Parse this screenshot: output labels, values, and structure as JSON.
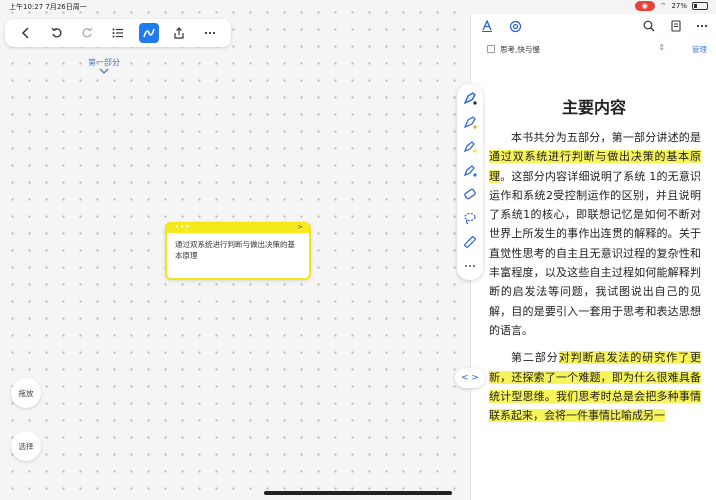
{
  "status_bar": {
    "time": "上午10:27  7月26日周一",
    "battery": "27%"
  },
  "toolbar": {
    "icons": [
      "chevron-left-icon",
      "undo-icon",
      "redo-icon",
      "outline-list-icon",
      "pen-mode-icon",
      "share-icon",
      "more-icon"
    ],
    "active": "pen-mode-icon",
    "accent": "#1e7bf2"
  },
  "canvas": {
    "section_label": "第一部分",
    "node_text": "通过双系统进行判断与做出决策的基本原理",
    "node_dots": "•••",
    "node_arrow": ">",
    "side_buttons": {
      "drag": "拖放",
      "select": "选择"
    }
  },
  "reader": {
    "book_title": "思考,快与慢",
    "sort_icon": "sort-icon",
    "manage_label": "管理",
    "doc_title": "主要内容",
    "paragraphs": [
      {
        "plain_before": "本书共分为五部分，第一部分讲述的是",
        "highlight": "通过双系统进行判断与做出决策的基本原理",
        "plain_after": "。这部分内容详细说明了系统 1的无意识运作和系统2受控制运作的区别，并且说明了系统1的核心，即联想记忆是如何不断对世界上所发生的事作出连贯的解释的。关于直觉性思考的自主且无意识过程的复杂性和丰富程度，以及这些自主过程如何能解释判断的启发法等问题，我试图说出自己的见解，目的是要引入一套用于思考和表达思想的语言。"
      },
      {
        "plain_before": "第二部分",
        "highlight": "对判断启发法的研究作了更新，还探索了一个难题，即为什么很难具备统计型思维。我们思考时总是会把多种事情联系起来，会将一件事情比喻成另一",
        "plain_after": ""
      }
    ],
    "highlight_color": "#f7f35a",
    "pane_toggle": "< >"
  }
}
